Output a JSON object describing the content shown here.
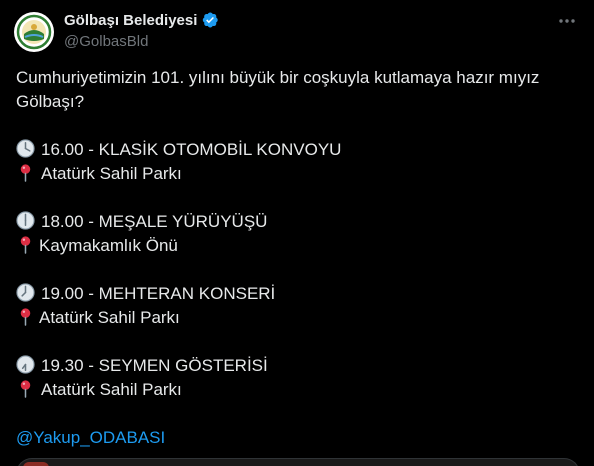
{
  "author": {
    "display_name": "Gölbaşı Belediyesi",
    "handle": "@GolbasBld",
    "verified_icon": "verified-badge-icon",
    "avatar_icon": "municipality-seal-icon"
  },
  "more_icon": "more-options-icon",
  "tweet": {
    "intro_line_1": "Cumhuriyetimizin 101. yılını büyük bir coşkuyla kutlamaya hazır mıyız",
    "intro_line_2": "Gölbaşı?",
    "events": [
      {
        "clock_icon": "clock-four-icon",
        "time_title": "16.00 - KLASİK OTOMOBİL KONVOYU",
        "pin_icon": "round-pushpin-icon",
        "location": "Atatürk Sahil Parkı"
      },
      {
        "clock_icon": "clock-six-icon",
        "time_title": "18.00 - MEŞALE YÜRÜYÜŞÜ",
        "pin_icon": "round-pushpin-icon",
        "location": "Kaymakamlık Önü"
      },
      {
        "clock_icon": "clock-seven-icon",
        "time_title": "19.00 - MEHTERAN KONSERİ",
        "pin_icon": "round-pushpin-icon",
        "location": "Atatürk Sahil Parkı"
      },
      {
        "clock_icon": "clock-seven-thirty-icon",
        "time_title": "19.30 - SEYMEN GÖSTERİSİ",
        "pin_icon": "round-pushpin-icon",
        "location": "Atatürk Sahil Parkı"
      }
    ],
    "mention": "@Yakup_ODABASI"
  },
  "colors": {
    "background": "#000000",
    "text": "#e7e9ea",
    "secondary_text": "#71767b",
    "link": "#1d9bf0",
    "verified": "#1d9bf0"
  }
}
